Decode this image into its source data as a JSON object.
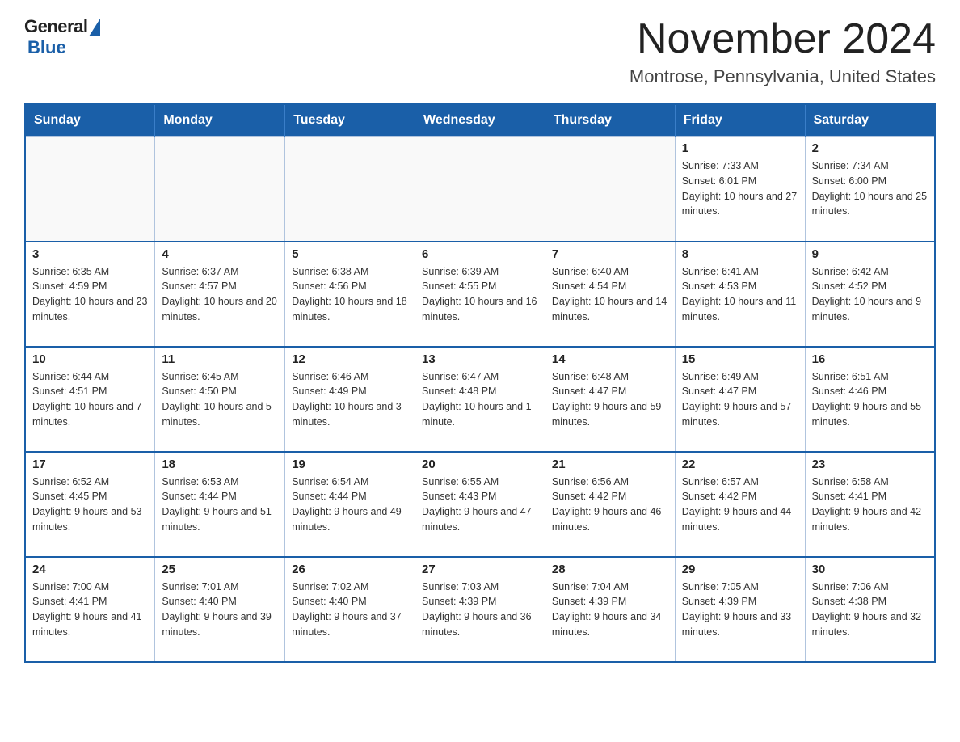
{
  "logo": {
    "general": "General",
    "blue": "Blue"
  },
  "title": "November 2024",
  "subtitle": "Montrose, Pennsylvania, United States",
  "weekdays": [
    "Sunday",
    "Monday",
    "Tuesday",
    "Wednesday",
    "Thursday",
    "Friday",
    "Saturday"
  ],
  "weeks": [
    [
      {
        "day": "",
        "info": ""
      },
      {
        "day": "",
        "info": ""
      },
      {
        "day": "",
        "info": ""
      },
      {
        "day": "",
        "info": ""
      },
      {
        "day": "",
        "info": ""
      },
      {
        "day": "1",
        "info": "Sunrise: 7:33 AM\nSunset: 6:01 PM\nDaylight: 10 hours and 27 minutes."
      },
      {
        "day": "2",
        "info": "Sunrise: 7:34 AM\nSunset: 6:00 PM\nDaylight: 10 hours and 25 minutes."
      }
    ],
    [
      {
        "day": "3",
        "info": "Sunrise: 6:35 AM\nSunset: 4:59 PM\nDaylight: 10 hours and 23 minutes."
      },
      {
        "day": "4",
        "info": "Sunrise: 6:37 AM\nSunset: 4:57 PM\nDaylight: 10 hours and 20 minutes."
      },
      {
        "day": "5",
        "info": "Sunrise: 6:38 AM\nSunset: 4:56 PM\nDaylight: 10 hours and 18 minutes."
      },
      {
        "day": "6",
        "info": "Sunrise: 6:39 AM\nSunset: 4:55 PM\nDaylight: 10 hours and 16 minutes."
      },
      {
        "day": "7",
        "info": "Sunrise: 6:40 AM\nSunset: 4:54 PM\nDaylight: 10 hours and 14 minutes."
      },
      {
        "day": "8",
        "info": "Sunrise: 6:41 AM\nSunset: 4:53 PM\nDaylight: 10 hours and 11 minutes."
      },
      {
        "day": "9",
        "info": "Sunrise: 6:42 AM\nSunset: 4:52 PM\nDaylight: 10 hours and 9 minutes."
      }
    ],
    [
      {
        "day": "10",
        "info": "Sunrise: 6:44 AM\nSunset: 4:51 PM\nDaylight: 10 hours and 7 minutes."
      },
      {
        "day": "11",
        "info": "Sunrise: 6:45 AM\nSunset: 4:50 PM\nDaylight: 10 hours and 5 minutes."
      },
      {
        "day": "12",
        "info": "Sunrise: 6:46 AM\nSunset: 4:49 PM\nDaylight: 10 hours and 3 minutes."
      },
      {
        "day": "13",
        "info": "Sunrise: 6:47 AM\nSunset: 4:48 PM\nDaylight: 10 hours and 1 minute."
      },
      {
        "day": "14",
        "info": "Sunrise: 6:48 AM\nSunset: 4:47 PM\nDaylight: 9 hours and 59 minutes."
      },
      {
        "day": "15",
        "info": "Sunrise: 6:49 AM\nSunset: 4:47 PM\nDaylight: 9 hours and 57 minutes."
      },
      {
        "day": "16",
        "info": "Sunrise: 6:51 AM\nSunset: 4:46 PM\nDaylight: 9 hours and 55 minutes."
      }
    ],
    [
      {
        "day": "17",
        "info": "Sunrise: 6:52 AM\nSunset: 4:45 PM\nDaylight: 9 hours and 53 minutes."
      },
      {
        "day": "18",
        "info": "Sunrise: 6:53 AM\nSunset: 4:44 PM\nDaylight: 9 hours and 51 minutes."
      },
      {
        "day": "19",
        "info": "Sunrise: 6:54 AM\nSunset: 4:44 PM\nDaylight: 9 hours and 49 minutes."
      },
      {
        "day": "20",
        "info": "Sunrise: 6:55 AM\nSunset: 4:43 PM\nDaylight: 9 hours and 47 minutes."
      },
      {
        "day": "21",
        "info": "Sunrise: 6:56 AM\nSunset: 4:42 PM\nDaylight: 9 hours and 46 minutes."
      },
      {
        "day": "22",
        "info": "Sunrise: 6:57 AM\nSunset: 4:42 PM\nDaylight: 9 hours and 44 minutes."
      },
      {
        "day": "23",
        "info": "Sunrise: 6:58 AM\nSunset: 4:41 PM\nDaylight: 9 hours and 42 minutes."
      }
    ],
    [
      {
        "day": "24",
        "info": "Sunrise: 7:00 AM\nSunset: 4:41 PM\nDaylight: 9 hours and 41 minutes."
      },
      {
        "day": "25",
        "info": "Sunrise: 7:01 AM\nSunset: 4:40 PM\nDaylight: 9 hours and 39 minutes."
      },
      {
        "day": "26",
        "info": "Sunrise: 7:02 AM\nSunset: 4:40 PM\nDaylight: 9 hours and 37 minutes."
      },
      {
        "day": "27",
        "info": "Sunrise: 7:03 AM\nSunset: 4:39 PM\nDaylight: 9 hours and 36 minutes."
      },
      {
        "day": "28",
        "info": "Sunrise: 7:04 AM\nSunset: 4:39 PM\nDaylight: 9 hours and 34 minutes."
      },
      {
        "day": "29",
        "info": "Sunrise: 7:05 AM\nSunset: 4:39 PM\nDaylight: 9 hours and 33 minutes."
      },
      {
        "day": "30",
        "info": "Sunrise: 7:06 AM\nSunset: 4:38 PM\nDaylight: 9 hours and 32 minutes."
      }
    ]
  ]
}
